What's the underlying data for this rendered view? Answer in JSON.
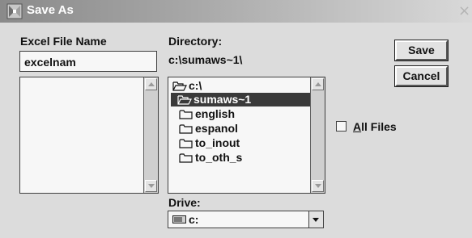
{
  "window": {
    "title": "Save As",
    "close_glyph": "×"
  },
  "file_name": {
    "label": "Excel File Name",
    "value": "excelnam"
  },
  "directory": {
    "label": "Directory:",
    "path": "c:\\sumaws~1\\",
    "items": [
      {
        "label": "c:\\",
        "icon": "open-folder-icon",
        "selected": false,
        "indent": 0
      },
      {
        "label": "sumaws~1",
        "icon": "open-folder-icon",
        "selected": true,
        "indent": 1
      },
      {
        "label": "english",
        "icon": "folder-icon",
        "selected": false,
        "indent": 2
      },
      {
        "label": "espanol",
        "icon": "folder-icon",
        "selected": false,
        "indent": 2
      },
      {
        "label": "to_inout",
        "icon": "folder-icon",
        "selected": false,
        "indent": 2
      },
      {
        "label": "to_oth_s",
        "icon": "folder-icon",
        "selected": false,
        "indent": 2
      }
    ]
  },
  "buttons": {
    "save": "Save",
    "cancel": "Cancel"
  },
  "all_files": {
    "mnemonic": "A",
    "rest": "ll Files",
    "checked": false
  },
  "drive": {
    "label": "Drive:",
    "value": "c:",
    "icon": "drive-icon"
  }
}
